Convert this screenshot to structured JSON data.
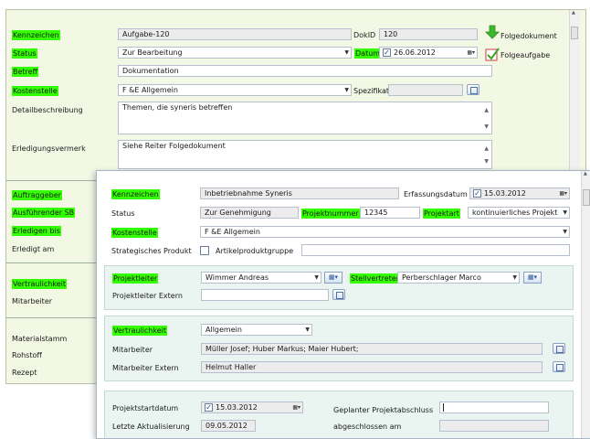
{
  "back": {
    "kennzeichen_label": "Kennzeichen",
    "kennzeichen_value": "Aufgabe-120",
    "dokid_label": "DokID",
    "dokid_value": "120",
    "folgedokument": "Folgedokument",
    "status_label": "Status",
    "status_value": "Zur Bearbeitung",
    "datum_label": "Datum",
    "datum_value": "26.06.2012",
    "folgeaufgabe": "Folgeaufgabe",
    "betreff_label": "Betreff",
    "betreff_value": "Dokumentation",
    "kostenstelle_label": "Kostenstelle",
    "kostenstelle_value": "F &E Allgemein",
    "spezifikation_label": "Spezifikation",
    "detail_label": "Detailbeschreibung",
    "detail_value": "Themen, die syneris betreffen",
    "erledigung_label": "Erledigungsvermerk",
    "erledigung_value": "Siehe Reiter Folgedokument",
    "auftraggeber_label": "Auftraggeber",
    "ausfuehrender_label": "Ausführender SB",
    "erledigen_label": "Erledigen bis",
    "erledigt_label": "Erledigt am",
    "vertraulichkeit_label": "Vertraulichkeit",
    "mitarbeiter_label": "Mitarbeiter",
    "materialstamm_label": "Materialstamm",
    "rohstoff_label": "Rohstoff",
    "rezept_label": "Rezept"
  },
  "front": {
    "kennzeichen_label": "Kennzeichen",
    "kennzeichen_value": "Inbetriebnahme Syneris",
    "erfassungsdatum_label": "Erfassungsdatum",
    "erfassungsdatum_value": "15.03.2012",
    "status_label": "Status",
    "status_value": "Zur Genehmigung",
    "projektnummer_label": "Projektnummer",
    "projektnummer_value": "12345",
    "projektart_label": "Projektart",
    "projektart_value": "kontinuierliches Projekt",
    "kostenstelle_label": "Kostenstelle",
    "kostenstelle_value": "F &E Allgemein",
    "strategisch_label": "Strategisches Produkt",
    "artikelgruppe_label": "Artikelproduktgruppe",
    "projektleiter_label": "Projektleiter",
    "projektleiter_value": "Wimmer Andreas",
    "stellvertreter_label": "Stellvertreter",
    "stellvertreter_value": "Perberschlager Marco",
    "projektleiter_extern_label": "Projektleiter Extern",
    "vertraulichkeit_label": "Vertraulichkeit",
    "vertraulichkeit_value": "Allgemein",
    "mitarbeiter_label": "Mitarbeiter",
    "mitarbeiter_value": "Müller Josef; Huber Markus; Maier Hubert;",
    "mitarbeiter_extern_label": "Mitarbeiter Extern",
    "mitarbeiter_extern_value": "Helmut Haller",
    "projektstart_label": "Projektstartdatum",
    "projektstart_value": "15.03.2012",
    "geplanter_label": "Geplanter Projektabschluss",
    "letzte_label": "Letzte Aktualisierung",
    "letzte_value": "09.05.2012",
    "abgeschlossen_label": "abgeschlossen am"
  },
  "colors": {
    "highlight": "#33ff00",
    "back_bg": "#f3f8e4",
    "section_bg": "#eaf5f2"
  },
  "icons": [
    "arrow-down-green-icon",
    "checkmark-task-icon",
    "calendar-icon",
    "lookup-icon",
    "people-picker-icon"
  ]
}
